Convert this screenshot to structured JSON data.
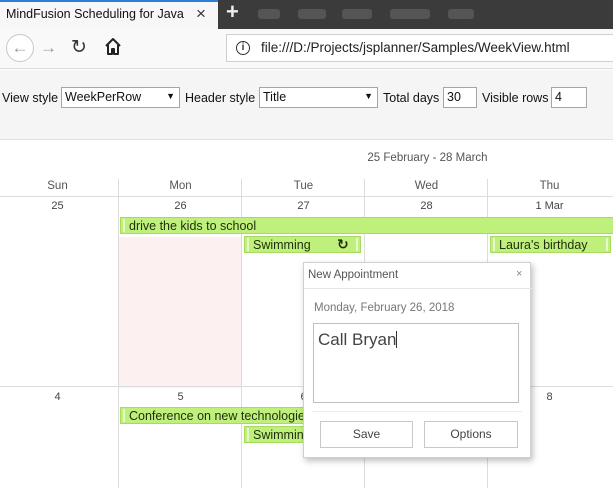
{
  "browser": {
    "tab_title": "MindFusion Scheduling for JavaScript",
    "tab_close": "×",
    "new_tab": "+",
    "back": "←",
    "forward": "→",
    "reload": "↻",
    "info": "i",
    "url": "file:///D:/Projects/jsplanner/Samples/WeekView.html"
  },
  "toolbar": {
    "view_style_label": "View style",
    "view_style_value": "WeekPerRow",
    "header_style_label": "Header style",
    "header_style_value": "Title",
    "total_days_label": "Total days",
    "total_days_value": "30",
    "visible_rows_label": "Visible rows",
    "visible_rows_value": "4"
  },
  "calendar": {
    "title": "25 February - 28 March",
    "day_names": [
      "Sun",
      "Mon",
      "Tue",
      "Wed",
      "Thu"
    ],
    "week1_days": [
      "25",
      "26",
      "27",
      "28",
      "1 Mar"
    ],
    "week2_days": [
      "4",
      "5",
      "6",
      "",
      "8"
    ],
    "events": {
      "kids": "drive the kids to school",
      "swim1": "Swimming",
      "birthday": "Laura's birthday",
      "conference": "Conference on new technologies",
      "swim2": "Swimming"
    },
    "recurrence_icon": "↻"
  },
  "dialog": {
    "title": "New Appointment",
    "close": "×",
    "date": "Monday, February 26, 2018",
    "text": "Call Bryan",
    "save_label": "Save",
    "options_label": "Options"
  },
  "colors": {
    "event_fill": "#bff07b",
    "today_fill": "#fdf0f0",
    "tab_accent": "#2b7fd8"
  }
}
